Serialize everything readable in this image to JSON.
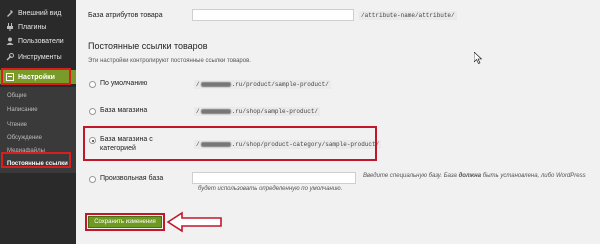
{
  "sidebar": {
    "items": [
      {
        "label": "Внешний вид",
        "icon": "appearance-icon"
      },
      {
        "label": "Плагины",
        "icon": "plugins-icon"
      },
      {
        "label": "Пользователи",
        "icon": "users-icon"
      },
      {
        "label": "Инструменты",
        "icon": "tools-icon"
      },
      {
        "label": "Настройки",
        "icon": "settings-icon"
      }
    ],
    "submenu": [
      {
        "label": "Общие"
      },
      {
        "label": "Написание"
      },
      {
        "label": "Чтение"
      },
      {
        "label": "Обсуждение"
      },
      {
        "label": "Медиафайлы"
      },
      {
        "label": "Постоянные ссылки"
      }
    ]
  },
  "attribute_base": {
    "label": "База атрибутов товара",
    "hint": "/attribute-name/attribute/"
  },
  "section": {
    "title": "Постоянные ссылки товаров",
    "description": "Эти настройки контролируют постоянные ссылки товаров."
  },
  "options": [
    {
      "label": "По умолчанию",
      "url_prefix": "/",
      "url_suffix": ".ru/product/sample-product/"
    },
    {
      "label": "База магазина",
      "url_prefix": "/",
      "url_suffix": ".ru/shop/sample-product/"
    },
    {
      "label": "База магазина с категорией",
      "url_prefix": "/",
      "url_suffix": ".ru/shop/product-category/sample-product/"
    },
    {
      "label": "Произвольная база"
    }
  ],
  "custom_note": {
    "part1": "Введите специальную базу. База ",
    "bold": "должна",
    "part2": " быть установлена, либо WordPress",
    "line2": "будет использовать определенную по умолчанию."
  },
  "save_button": "Сохранить изменения",
  "colors": {
    "accent": "#7a9a2a",
    "highlight": "#c0182a",
    "sidebar": "#2a2a2a"
  }
}
